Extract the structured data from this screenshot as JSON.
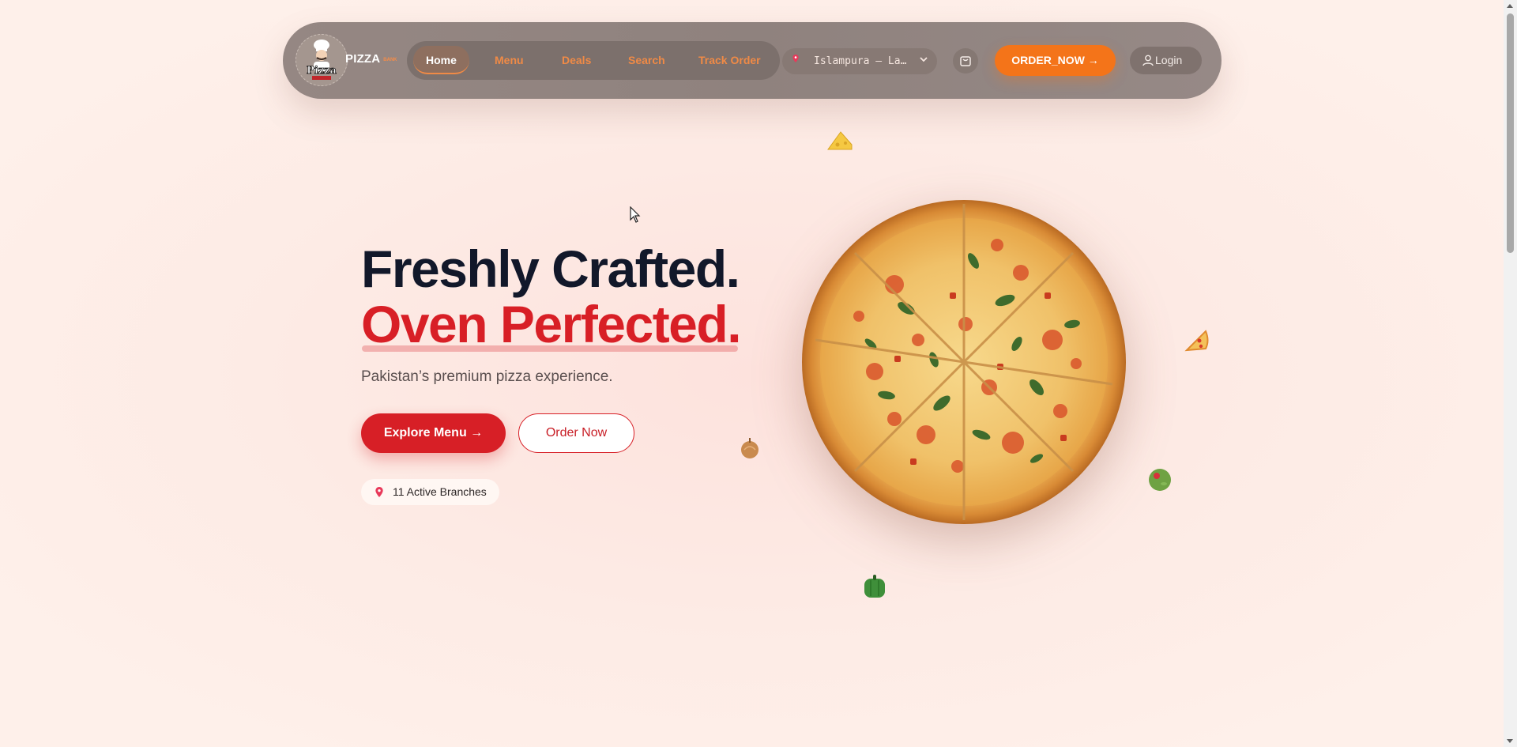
{
  "brand": {
    "name": "PIZZA",
    "tag": "ᴮᴬᴺᴷ"
  },
  "nav": {
    "items": [
      {
        "label": "Home",
        "active": true
      },
      {
        "label": "Menu",
        "active": false
      },
      {
        "label": "Deals",
        "active": false
      },
      {
        "label": "Search",
        "active": false
      },
      {
        "label": "Track Order",
        "active": false
      }
    ]
  },
  "location": {
    "selected": "Islampura – La…",
    "icon": "map-pin-icon"
  },
  "actions": {
    "cart_icon": "shopping-bag-icon",
    "order_label": "ORDER_NOW →",
    "login_label": "Login",
    "login_icon": "user-icon"
  },
  "hero": {
    "headline_line1": "Freshly Crafted.",
    "headline_line2": "Oven Perfected.",
    "subtitle": "Pakistan’s premium pizza experience.",
    "primary_cta": "Explore Menu →",
    "secondary_cta": "Order Now",
    "branches_badge": "11 Active Branches"
  },
  "decorations": [
    "cheese-icon",
    "pizza-slice-icon",
    "onion-icon",
    "olive-icon",
    "bell-pepper-icon"
  ],
  "colors": {
    "accent_orange": "#f47419",
    "accent_red": "#d71f26",
    "heading_dark": "#12182a",
    "nav_bg": "#8f827e"
  }
}
